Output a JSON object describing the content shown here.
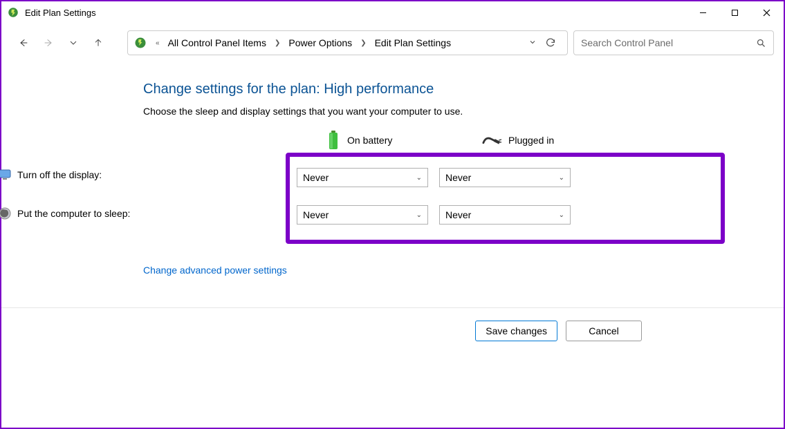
{
  "window": {
    "title": "Edit Plan Settings"
  },
  "breadcrumb": {
    "items": [
      "All Control Panel Items",
      "Power Options",
      "Edit Plan Settings"
    ]
  },
  "search": {
    "placeholder": "Search Control Panel"
  },
  "page": {
    "heading": "Change settings for the plan: High performance",
    "description": "Choose the sleep and display settings that you want your computer to use."
  },
  "columns": {
    "battery": "On battery",
    "plugged": "Plugged in"
  },
  "settings": {
    "display": {
      "label": "Turn off the display:",
      "battery_value": "Never",
      "plugged_value": "Never"
    },
    "sleep": {
      "label": "Put the computer to sleep:",
      "battery_value": "Never",
      "plugged_value": "Never"
    }
  },
  "links": {
    "advanced": "Change advanced power settings"
  },
  "buttons": {
    "save": "Save changes",
    "cancel": "Cancel"
  }
}
